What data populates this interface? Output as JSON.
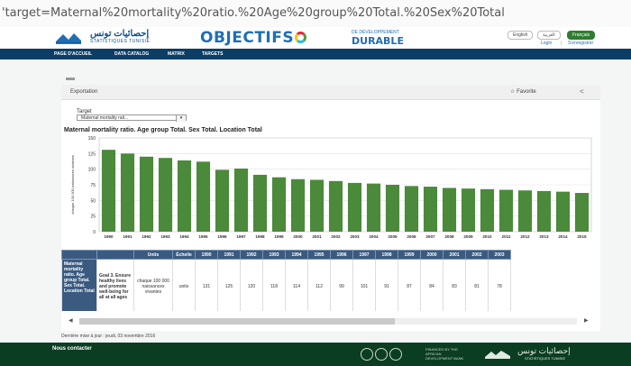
{
  "browser": {
    "url": "'target=Maternal%20mortality%20ratio.%20Age%20group%20Total.%20Sex%20Total"
  },
  "header": {
    "logo_ar": "إحصائيات تونس",
    "logo_fr": "STATISTIQUES TUNISIE",
    "objectifs": "OBJECTIFS",
    "objectifs_sub": "DE DÉVELOPPEMENT",
    "durable": "DURABLE",
    "languages": [
      "English",
      "العربية",
      "Français"
    ],
    "active_language": "Français",
    "login": "Login",
    "register": "S'enregistrer"
  },
  "nav": {
    "items": [
      "PAGE D'ACCUEIL",
      "DATA CATALOG",
      "MATRIX",
      "TARGETS"
    ]
  },
  "toolbar": {
    "export_label": "Exportation",
    "favorite_label": "Favorite"
  },
  "target": {
    "label": "Target",
    "selected": "Maternal mortality rati..."
  },
  "chart_data": {
    "type": "bar",
    "title": "Maternal mortality ratio. Age group Total. Sex Total. Location Total",
    "ylabel": "chaque 100 000 naissances vivantes",
    "ylim": [
      0,
      150
    ],
    "yticks": [
      0,
      25,
      50,
      75,
      100,
      125,
      150
    ],
    "categories": [
      "1990",
      "1991",
      "1992",
      "1993",
      "1994",
      "1995",
      "1996",
      "1997",
      "1998",
      "1999",
      "2000",
      "2001",
      "2002",
      "2003",
      "2004",
      "2005",
      "2006",
      "2007",
      "2008",
      "2009",
      "2010",
      "2011",
      "2012",
      "2013",
      "2014",
      "2015"
    ],
    "values": [
      131,
      125,
      120,
      118,
      114,
      112,
      99,
      101,
      91,
      87,
      84,
      83,
      81,
      78,
      77,
      75,
      73,
      72,
      70,
      69,
      68,
      67,
      66,
      65,
      64,
      62
    ],
    "bar_color": "#4a8a3a",
    "grid": true
  },
  "table": {
    "headers": [
      "",
      "",
      "Units",
      "Échelle",
      "1990",
      "1991",
      "1992",
      "1993",
      "1994",
      "1995",
      "1996",
      "1997",
      "1998",
      "1999",
      "2000",
      "2001",
      "2002",
      "2003"
    ],
    "indicator": "Maternal mortality ratio. Age group Total. Sex Total. Location Total",
    "goal": "Goal 3. Ensure healthy lives and promote well-being for all at all ages",
    "unit": "chaque 100 000 naissances vivantes",
    "scale": "units",
    "values": [
      "131",
      "125",
      "120",
      "118",
      "114",
      "112",
      "99",
      "101",
      "91",
      "87",
      "84",
      "83",
      "81",
      "78"
    ]
  },
  "updated": "Dernière mise à jour : jeudi, 03 novembre 2016",
  "footer": {
    "contact": "Nous contacter",
    "partner_text": "FINANCED BY THE AFRICAN DEVELOPMENT BANK",
    "logo_ar": "إحصائيات تونس",
    "logo_fr": "STATISTIQUES TUNISIE"
  }
}
